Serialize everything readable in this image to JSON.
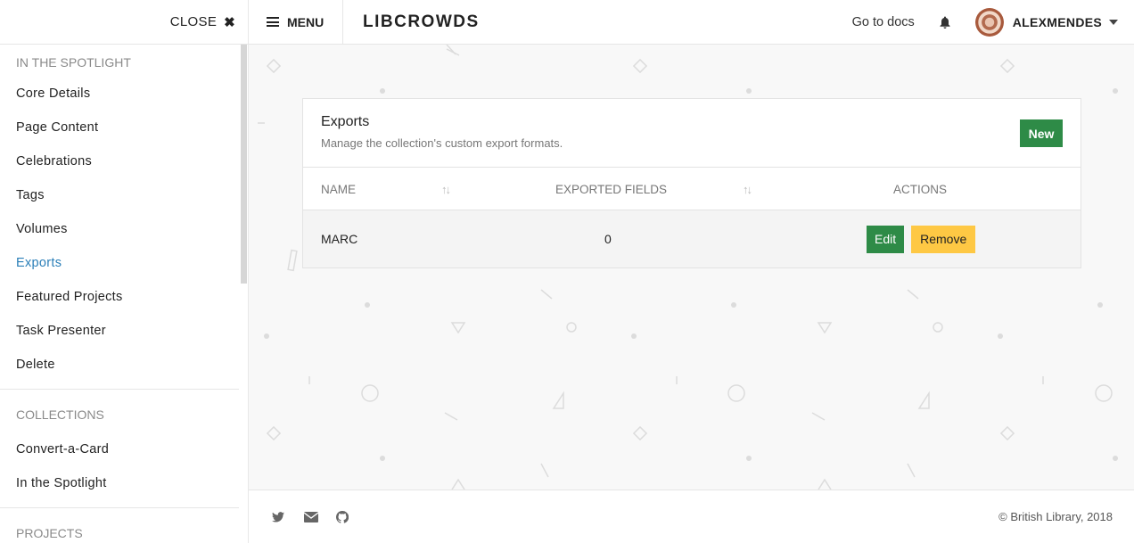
{
  "sidebar": {
    "close_label": "CLOSE",
    "close_glyph": "✖",
    "sections": [
      {
        "title": "IN THE SPOTLIGHT",
        "items": [
          "Core Details",
          "Page Content",
          "Celebrations",
          "Tags",
          "Volumes",
          "Exports",
          "Featured Projects",
          "Task Presenter",
          "Delete"
        ]
      },
      {
        "title": "COLLECTIONS",
        "items": [
          "Convert-a-Card",
          "In the Spotlight"
        ]
      },
      {
        "title": "PROJECTS",
        "items": []
      }
    ],
    "active_item": "Exports"
  },
  "topbar": {
    "menu_label": "MENU",
    "brand": "LIBCROWDS",
    "docs_link": "Go to docs",
    "username": "ALEXMENDES",
    "notification_icon": "bell-icon"
  },
  "card": {
    "title": "Exports",
    "subtitle": "Manage the collection's custom export formats.",
    "new_button": "New",
    "columns": [
      "NAME",
      "EXPORTED FIELDS",
      "ACTIONS"
    ],
    "rows": [
      {
        "name": "MARC",
        "exported_fields": "0",
        "edit_label": "Edit",
        "remove_label": "Remove"
      }
    ]
  },
  "footer": {
    "icons": [
      "twitter-icon",
      "envelope-icon",
      "github-icon"
    ],
    "copyright": "© British Library, 2018"
  },
  "colors": {
    "primary_green": "#2e8b47",
    "warning_yellow": "#fec844",
    "active_link": "#2b7fb8"
  }
}
